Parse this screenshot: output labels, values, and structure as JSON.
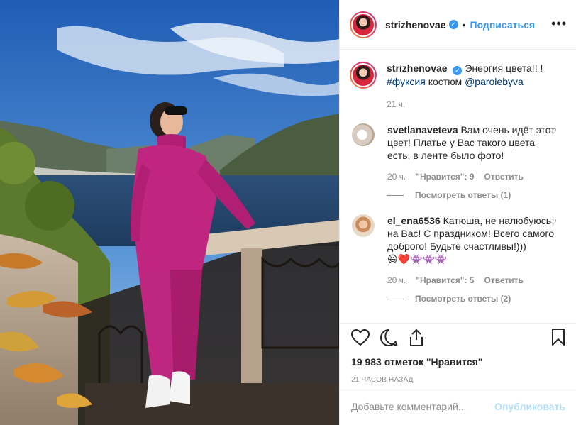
{
  "header": {
    "username": "strizhenovae",
    "separator": "•",
    "follow_label": "Подписаться",
    "more_label": "•••"
  },
  "caption": {
    "username": "strizhenovae",
    "text_before": "Энергия цвета!! !",
    "hashtag": "#фуксия",
    "text_middle": "костюм",
    "mention": "@parolebyva",
    "time": "21 ч."
  },
  "comments": [
    {
      "username": "svetlanaveteva",
      "text": "Вам очень идёт этот цвет! Платье у Вас такого цвета есть, в ленте было фото!",
      "time": "20 ч.",
      "likes_label": "\"Нравится\": 9",
      "reply_label": "Ответить",
      "view_replies": "Посмотреть ответы (1)"
    },
    {
      "username": "el_ena6536",
      "text": "Катюша, не налюбуюсь на Вас! С праздником! Всего самого доброго! Будьте счастлмвы!)))",
      "emoji": "😆❤️👾👾👾",
      "time": "20 ч.",
      "likes_label": "\"Нравится\": 5",
      "reply_label": "Ответить",
      "view_replies": "Посмотреть ответы (2)"
    }
  ],
  "actions": {
    "likes": "19 983 отметок \"Нравится\"",
    "time_ago": "21 ЧАСОВ НАЗАД"
  },
  "add_comment": {
    "placeholder": "Добавьте комментарий...",
    "post_label": "Опубликовать"
  },
  "colors": {
    "link": "#3897f0",
    "post_disabled": "#b2dffc",
    "muted": "#8e8e8e"
  }
}
